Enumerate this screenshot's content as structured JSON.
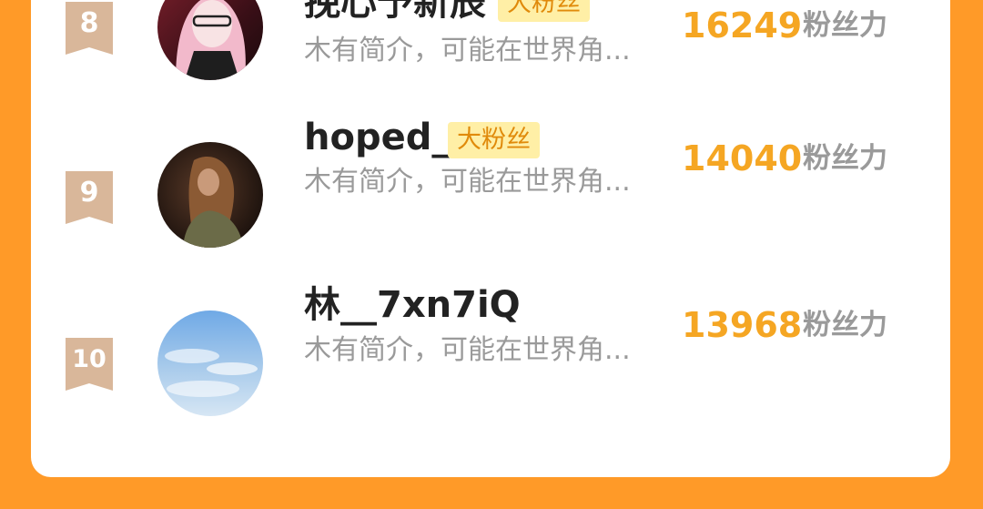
{
  "colors": {
    "page_background": "#FF9A28",
    "card_background": "#FFFFFF",
    "score_color": "#F5A623",
    "fan_tag_background": "#FFEFA6",
    "rank_badge_color": "#D9B79A"
  },
  "fans": [
    {
      "rank": "8",
      "name": "挽心予新辰",
      "badge": "大粉丝",
      "bio": "木有简介，可能在世界角...",
      "score": "16249",
      "score_unit": "粉丝力"
    },
    {
      "rank": "9",
      "name": "hoped_",
      "badge": "大粉丝",
      "bio": "木有简介，可能在世界角...",
      "score": "14040",
      "score_unit": "粉丝力"
    },
    {
      "rank": "10",
      "name": "林__7xn7iQ",
      "badge": "",
      "bio": "木有简介，可能在世界角...",
      "score": "13968",
      "score_unit": "粉丝力"
    }
  ]
}
